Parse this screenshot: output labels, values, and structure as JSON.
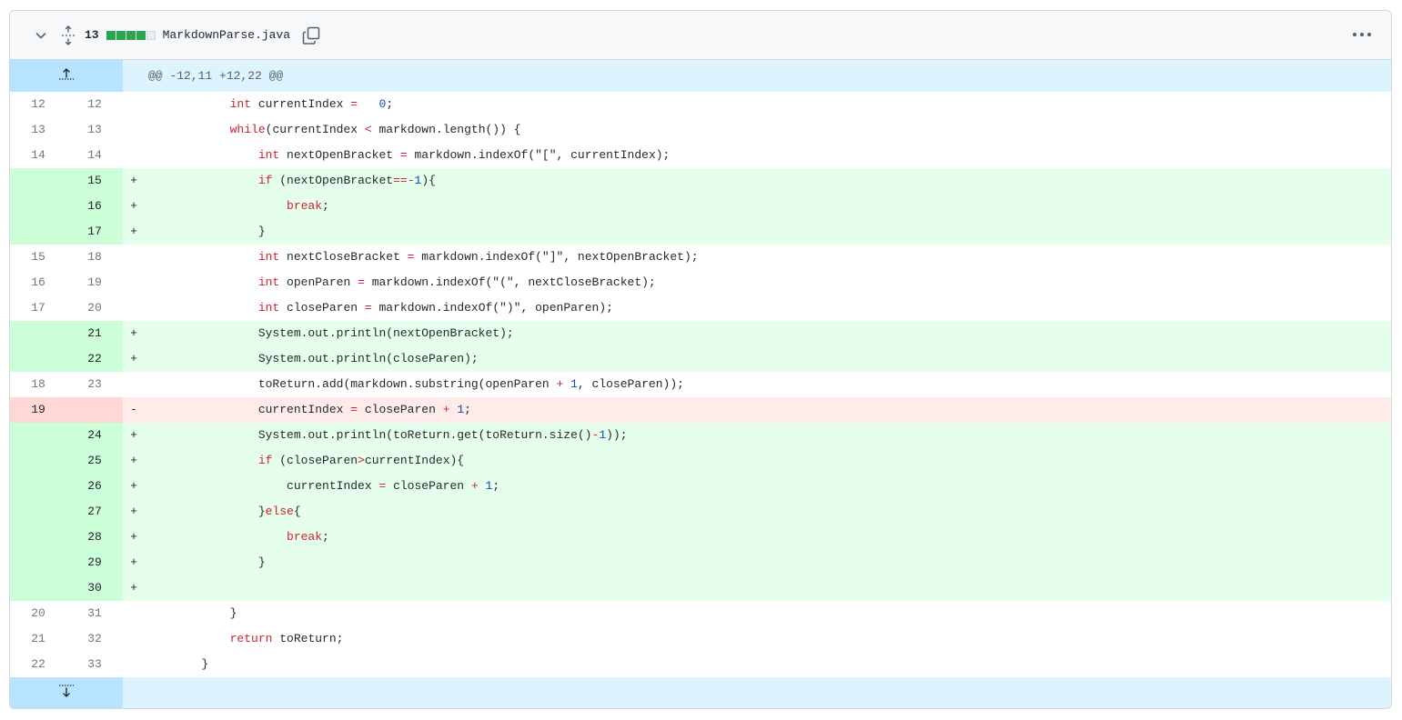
{
  "file": {
    "change_count": "13",
    "diffstat": [
      "add",
      "add",
      "add",
      "add",
      "neutral"
    ],
    "name": "MarkdownParse.java",
    "colors": {
      "add_square": "#2da44e",
      "neutral_square": "#eaeef2"
    },
    "icons": [
      "chevron-down-icon",
      "expand-all-icon",
      "copy-icon",
      "kebab-icon"
    ]
  },
  "hunk_header": "@@ -12,11 +12,22 @@",
  "lines": [
    {
      "type": "ctx",
      "old": "12",
      "new": "12",
      "sign": "",
      "indent": "            ",
      "tokens": [
        [
          "kw",
          "int"
        ],
        [
          "",
          "currentIndex "
        ],
        [
          "op",
          "="
        ],
        [
          "",
          "  "
        ],
        [
          "nm",
          "0"
        ],
        [
          "",
          ";"
        ]
      ]
    },
    {
      "type": "ctx",
      "old": "13",
      "new": "13",
      "sign": "",
      "indent": "            ",
      "tokens": [
        [
          "kw",
          "while"
        ],
        [
          "",
          "(currentIndex "
        ],
        [
          "op",
          "<"
        ],
        [
          "",
          ""
        ],
        [
          "",
          ""
        ],
        [
          "",
          ""
        ],
        [
          "",
          ""
        ],
        [
          "",
          ""
        ],
        [
          "",
          ""
        ],
        [
          "",
          ""
        ],
        [
          "",
          ""
        ],
        [
          "",
          "markdown.length()) {"
        ]
      ]
    },
    {
      "type": "ctx",
      "old": "14",
      "new": "14",
      "sign": "",
      "indent": "                ",
      "tokens": [
        [
          "kw",
          "int"
        ],
        [
          "",
          "nextOpenBracket "
        ],
        [
          "op",
          "="
        ],
        [
          "",
          "markdown.indexOf(\"[\", currentIndex);"
        ]
      ]
    },
    {
      "type": "add",
      "old": "",
      "new": "15",
      "sign": "+",
      "indent": "                ",
      "tokens": [
        [
          "kw",
          "if"
        ],
        [
          "",
          "(nextOpenBracket"
        ],
        [
          "op",
          "=="
        ],
        [
          "op",
          "-"
        ],
        [
          "nm",
          "1"
        ],
        [
          "",
          "){"
        ]
      ]
    },
    {
      "type": "add",
      "old": "",
      "new": "16",
      "sign": "+",
      "indent": "                    ",
      "tokens": [
        [
          "kw",
          "break"
        ],
        [
          "",
          ";"
        ]
      ]
    },
    {
      "type": "add",
      "old": "",
      "new": "17",
      "sign": "+",
      "indent": "                ",
      "tokens": [
        [
          "",
          "}"
        ]
      ]
    },
    {
      "type": "ctx",
      "old": "15",
      "new": "18",
      "sign": "",
      "indent": "                ",
      "tokens": [
        [
          "kw",
          "int"
        ],
        [
          "",
          "nextCloseBracket "
        ],
        [
          "op",
          "="
        ],
        [
          "",
          "markdown.indexOf(\"]\", nextOpenBracket);"
        ]
      ]
    },
    {
      "type": "ctx",
      "old": "16",
      "new": "19",
      "sign": "",
      "indent": "                ",
      "tokens": [
        [
          "kw",
          "int"
        ],
        [
          "",
          "openParen "
        ],
        [
          "op",
          "="
        ],
        [
          "",
          "markdown.indexOf(\"(\", nextCloseBracket);"
        ]
      ]
    },
    {
      "type": "ctx",
      "old": "17",
      "new": "20",
      "sign": "",
      "indent": "                ",
      "tokens": [
        [
          "kw",
          "int"
        ],
        [
          "",
          "closeParen "
        ],
        [
          "op",
          "="
        ],
        [
          "",
          "markdown.indexOf(\")\", openParen);"
        ]
      ]
    },
    {
      "type": "add",
      "old": "",
      "new": "21",
      "sign": "+",
      "indent": "                ",
      "tokens": [
        [
          "",
          "System.out.println(nextOpenBracket);"
        ]
      ]
    },
    {
      "type": "add",
      "old": "",
      "new": "22",
      "sign": "+",
      "indent": "                ",
      "tokens": [
        [
          "",
          "System.out.println(closeParen);"
        ]
      ]
    },
    {
      "type": "ctx",
      "old": "18",
      "new": "23",
      "sign": "",
      "indent": "                ",
      "tokens": [
        [
          "",
          "toReturn.add(markdown.substring(openParen "
        ],
        [
          "op",
          "+"
        ],
        [
          "",
          ""
        ],
        [
          "nm",
          "1"
        ],
        [
          "",
          ", closeParen));"
        ]
      ]
    },
    {
      "type": "del",
      "old": "19",
      "new": "",
      "sign": "-",
      "indent": "                ",
      "tokens": [
        [
          "",
          "currentIndex "
        ],
        [
          "op",
          "="
        ],
        [
          "",
          "closeParen "
        ],
        [
          "op",
          "+"
        ],
        [
          "",
          ""
        ],
        [
          "nm",
          "1"
        ],
        [
          "",
          ";"
        ]
      ]
    },
    {
      "type": "add",
      "old": "",
      "new": "24",
      "sign": "+",
      "indent": "                ",
      "tokens": [
        [
          "",
          "System.out.println(toReturn.get(toReturn.size()"
        ],
        [
          "op",
          "-"
        ],
        [
          "nm",
          "1"
        ],
        [
          "",
          "));"
        ]
      ]
    },
    {
      "type": "add",
      "old": "",
      "new": "25",
      "sign": "+",
      "indent": "                ",
      "tokens": [
        [
          "kw",
          "if"
        ],
        [
          "",
          ""
        ],
        [
          "",
          "(closeParen"
        ],
        [
          "op",
          ">"
        ],
        [
          "",
          "currentIndex){"
        ]
      ]
    },
    {
      "type": "add",
      "old": "",
      "new": "26",
      "sign": "+",
      "indent": "                    ",
      "tokens": [
        [
          "",
          "currentIndex "
        ],
        [
          "op",
          "="
        ],
        [
          "",
          "closeParen "
        ],
        [
          "op",
          "+"
        ],
        [
          "",
          ""
        ],
        [
          "nm",
          "1"
        ],
        [
          "",
          ";"
        ]
      ]
    },
    {
      "type": "add",
      "old": "",
      "new": "27",
      "sign": "+",
      "indent": "                ",
      "tokens": [
        [
          "",
          "}"
        ],
        [
          "kw",
          "else"
        ],
        [
          "",
          "{"
        ]
      ]
    },
    {
      "type": "add",
      "old": "",
      "new": "28",
      "sign": "+",
      "indent": "                    ",
      "tokens": [
        [
          "kw",
          "break"
        ],
        [
          "",
          ";"
        ]
      ]
    },
    {
      "type": "add",
      "old": "",
      "new": "29",
      "sign": "+",
      "indent": "                ",
      "tokens": [
        [
          "",
          "}"
        ]
      ]
    },
    {
      "type": "add",
      "old": "",
      "new": "30",
      "sign": "+",
      "indent": "",
      "tokens": []
    },
    {
      "type": "ctx",
      "old": "20",
      "new": "31",
      "sign": "",
      "indent": "            ",
      "tokens": [
        [
          "",
          "}"
        ]
      ]
    },
    {
      "type": "ctx",
      "old": "21",
      "new": "32",
      "sign": "",
      "indent": "            ",
      "tokens": [
        [
          "kw",
          "return"
        ],
        [
          "",
          "toReturn;"
        ]
      ]
    },
    {
      "type": "ctx",
      "old": "22",
      "new": "33",
      "sign": "",
      "indent": "        ",
      "tokens": [
        [
          "",
          "}"
        ]
      ]
    }
  ]
}
